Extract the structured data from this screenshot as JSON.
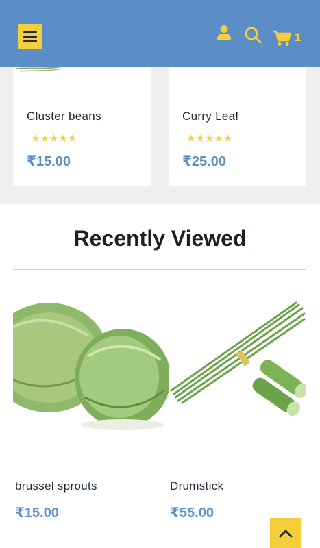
{
  "header": {
    "menu_icon": "hamburger-icon",
    "user_icon": "user-icon",
    "search_icon": "search-icon",
    "cart_icon": "cart-icon",
    "cart_count": "1",
    "colors": {
      "bar": "#5b8dc6",
      "accent": "#f5cf3b"
    }
  },
  "top_products": [
    {
      "name": "Cluster beans",
      "rating": "★★★★★",
      "price": "₹15.00"
    },
    {
      "name": "Curry Leaf",
      "rating": "★★★★★",
      "price": "₹25.00"
    }
  ],
  "recently_viewed": {
    "title": "Recently Viewed",
    "items": [
      {
        "name": "brussel sprouts",
        "price": "₹15.00",
        "image": "brussel-sprouts-photo"
      },
      {
        "name": "Drumstick",
        "price": "₹55.00",
        "image": "drumstick-photo"
      }
    ]
  },
  "back_to_top_icon": "chevron-up-icon"
}
